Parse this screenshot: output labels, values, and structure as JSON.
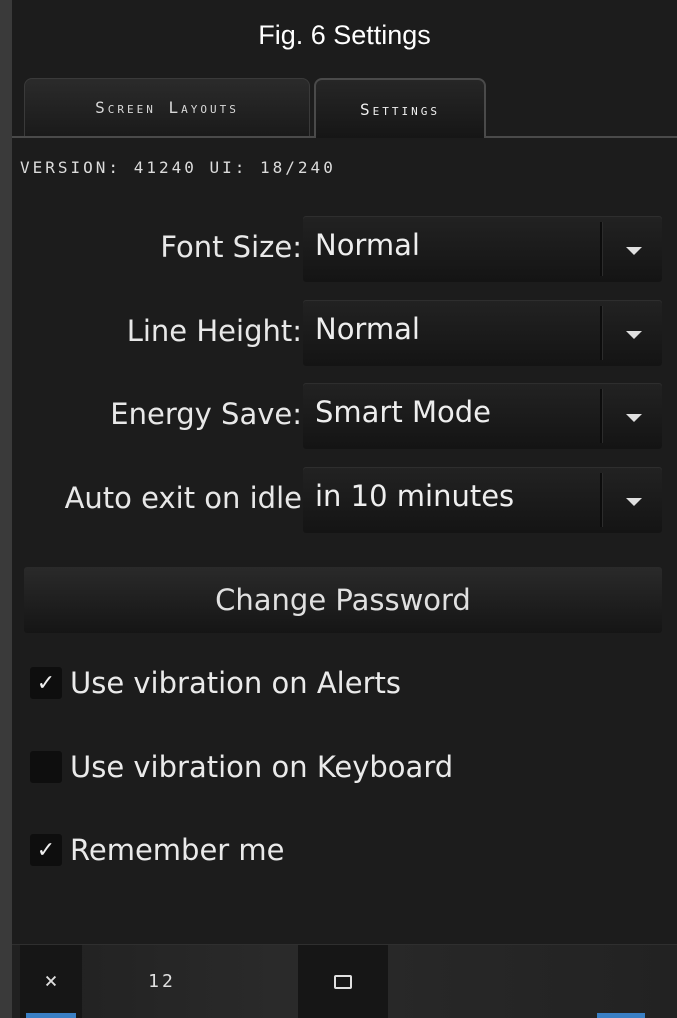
{
  "figure": {
    "title": "Fig. 6 Settings"
  },
  "tabs": [
    {
      "label": "Screen Layouts",
      "active": false
    },
    {
      "label": "Settings",
      "active": true
    }
  ],
  "version_text": "VERSION: 41240 UI: 18/240",
  "settings": [
    {
      "label": "Font Size:",
      "value": "Normal"
    },
    {
      "label": "Line Height:",
      "value": "Normal"
    },
    {
      "label": "Energy Save:",
      "value": "Smart Mode"
    },
    {
      "label": "Auto exit on idle",
      "value": "in 10 minutes"
    }
  ],
  "change_password_label": "Change Password",
  "checkboxes": [
    {
      "label": "Use vibration on Alerts",
      "checked": true
    },
    {
      "label": "Use vibration on Keyboard",
      "checked": false
    },
    {
      "label": "Remember me",
      "checked": true
    }
  ],
  "bottom_bar": {
    "close_glyph": "×",
    "count": "12",
    "window_icon": "window-icon"
  },
  "colors": {
    "background": "#1c1c1c",
    "indicator": "#3a7fc4"
  }
}
